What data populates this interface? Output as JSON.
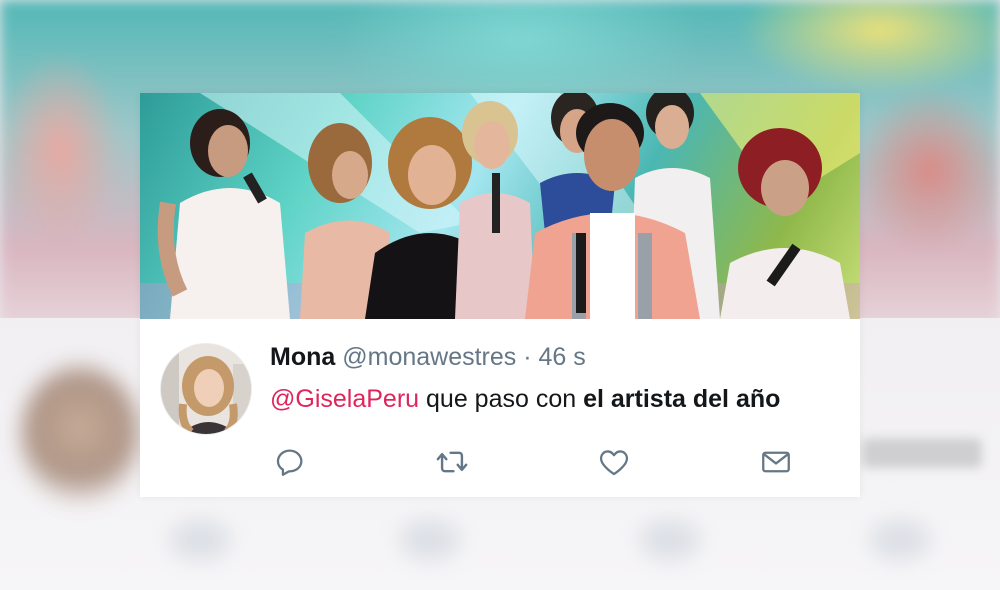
{
  "tweet": {
    "name": "Mona",
    "handle": "@monawestres",
    "separator": "·",
    "time": "46 s",
    "mention": "@GiselaPeru",
    "text_plain": "que paso con",
    "text_bold": "el artista del año"
  },
  "actions": [
    {
      "icon": "reply-icon"
    },
    {
      "icon": "retweet-icon"
    },
    {
      "icon": "like-icon"
    },
    {
      "icon": "direct-message-icon"
    }
  ],
  "colors": {
    "mention": "#e0245e",
    "secondary_text": "#657786",
    "icon": "#657786",
    "primary_text": "#14171a"
  }
}
